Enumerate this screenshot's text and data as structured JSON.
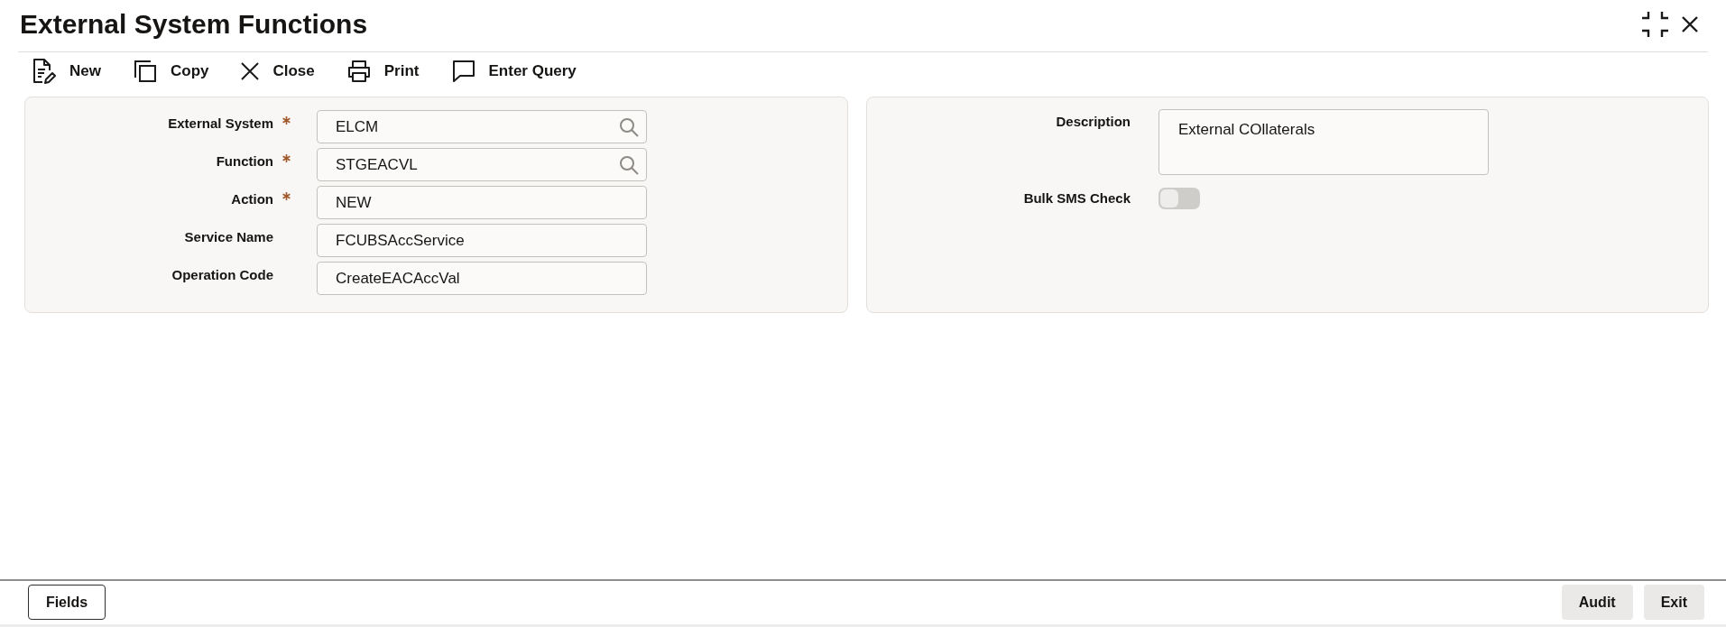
{
  "window": {
    "title": "External System Functions"
  },
  "toolbar": [
    {
      "label": "New"
    },
    {
      "label": "Copy"
    },
    {
      "label": "Close"
    },
    {
      "label": "Print"
    },
    {
      "label": "Enter Query"
    }
  ],
  "left_panel": {
    "fields": [
      {
        "label": "External System",
        "required": true,
        "value": "ELCM",
        "lookup": true
      },
      {
        "label": "Function",
        "required": true,
        "value": "STGEACVL",
        "lookup": true
      },
      {
        "label": "Action",
        "required": true,
        "value": "NEW",
        "lookup": false
      },
      {
        "label": "Service Name",
        "required": false,
        "value": "FCUBSAccService",
        "lookup": false
      },
      {
        "label": "Operation Code",
        "required": false,
        "value": "CreateEACAccVal",
        "lookup": false
      }
    ]
  },
  "right_panel": {
    "fields": [
      {
        "kind": "textarea",
        "label": "Description",
        "value": "External COllaterals"
      },
      {
        "kind": "toggle",
        "label": "Bulk SMS Check",
        "on": false
      }
    ]
  },
  "footer": {
    "left_buttons": [
      "Fields"
    ],
    "right_buttons": [
      "Audit",
      "Exit"
    ]
  }
}
